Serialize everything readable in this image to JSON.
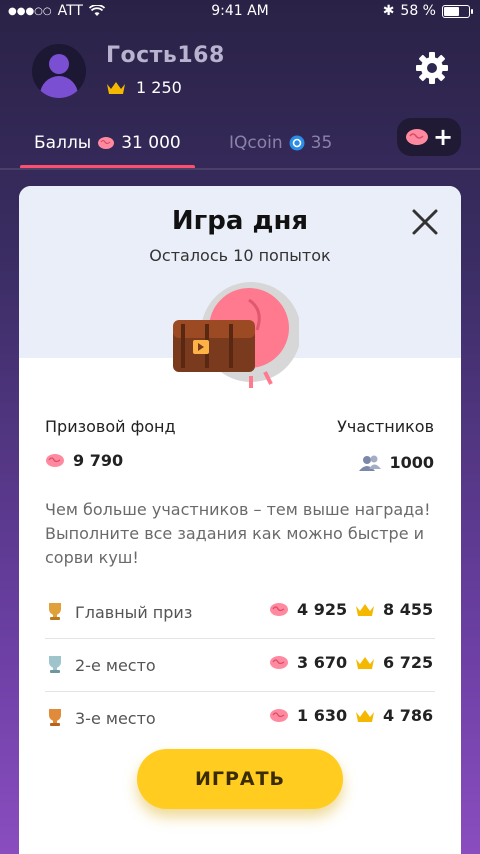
{
  "status_bar": {
    "carrier": "ATT",
    "time": "9:41 AM",
    "battery": "58 %"
  },
  "profile": {
    "username": "Гость168",
    "crowns": "1 250"
  },
  "tabs": [
    {
      "label": "Баллы",
      "value": "31 000"
    },
    {
      "label": "IQcoin",
      "value": "35"
    }
  ],
  "add_button": {
    "label": "+"
  },
  "card": {
    "title": "Игра дня",
    "subtitle": "Осталось 10 попыток",
    "prize_fund_label": "Призовой фонд",
    "prize_fund_value": "9 790",
    "participants_label": "Участников",
    "participants_value": "1000",
    "description": "Чем больше участников – тем выше награда! Выполните все задания как можно быстре и сорви куш!",
    "prizes": [
      {
        "name": "Главный приз",
        "points": "4 925",
        "crowns": "8 455",
        "trophy_color": "#e0a13a"
      },
      {
        "name": "2-е место",
        "points": "3 670",
        "crowns": "6 725",
        "trophy_color": "#9fc4cc"
      },
      {
        "name": "3-е место",
        "points": "1 630",
        "crowns": "4 786",
        "trophy_color": "#e08a3a"
      }
    ],
    "play_label": "ИГРАТЬ"
  },
  "colors": {
    "accent_pink": "#ff4f6e",
    "play_yellow": "#ffcc1f",
    "crown_gold": "#f5b800"
  }
}
